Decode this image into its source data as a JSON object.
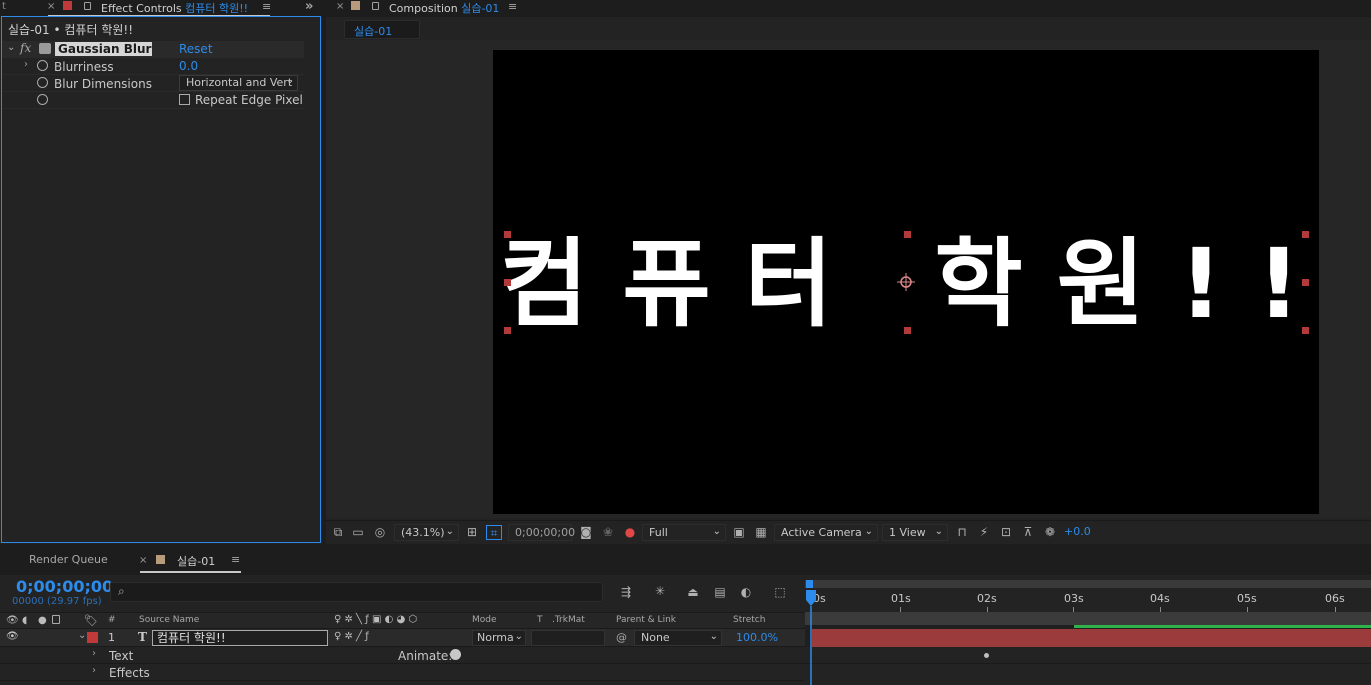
{
  "effect_controls": {
    "tab_close": "×",
    "tab_title": "Effect Controls",
    "tab_layer": "컴퓨터 학원!!",
    "expand_glyph": "»",
    "menu_glyph": "≡",
    "breadcrumb": "실습-01 • 컴퓨터 학원!!",
    "fx_label": "fx",
    "effect_name": "Gaussian Blur",
    "reset_label": "Reset",
    "properties": [
      {
        "name": "Blurriness",
        "value": "0.0"
      },
      {
        "name": "Blur Dimensions",
        "value": "Horizontal and Vert"
      },
      {
        "name": "",
        "value": "Repeat Edge Pixel"
      }
    ],
    "left_edge_glyph": "t"
  },
  "composition": {
    "tab_close": "×",
    "tab_title": "Composition",
    "tab_comp": "실습-01",
    "menu_glyph": "≡",
    "subtab": "실습-01",
    "canvas_text": "컴퓨터 학원!!",
    "toolbar": {
      "zoom": "(43.1%)",
      "timecode": "0;00;00;00",
      "resolution": "Full",
      "camera": "Active Camera",
      "views": "1 View",
      "exposure": "+0.0"
    }
  },
  "timeline": {
    "render_queue_tab": "Render Queue",
    "tab_close": "×",
    "comp_tab": "실습-01",
    "menu_glyph": "≡",
    "timecode": "0;00;00;00",
    "frame_info": "00000 (29.97 fps)",
    "search_placeholder": "",
    "columns": {
      "hash": "#",
      "source_name": "Source Name",
      "mode": "Mode",
      "t": "T",
      "trkmat": ".TrkMat",
      "parent_link": "Parent & Link",
      "stretch": "Stretch"
    },
    "layer": {
      "index": "1",
      "type_glyph": "T",
      "name": "컴퓨터 학원!!",
      "mode": "Norma",
      "parent": "None",
      "stretch": "100.0%"
    },
    "sub_rows": [
      {
        "label": "Text",
        "animate": "Animate:"
      },
      {
        "label": "Effects"
      }
    ],
    "ruler": [
      "0s",
      "01s",
      "02s",
      "03s",
      "04s",
      "05s",
      "06s"
    ]
  },
  "colors": {
    "accent_blue": "#2d8ceb",
    "layer_label_red": "#c03a3a",
    "comp_swatch": "#b89b7c",
    "bar_red": "#9b3b3b",
    "work_area_green": "#2fb24a"
  }
}
